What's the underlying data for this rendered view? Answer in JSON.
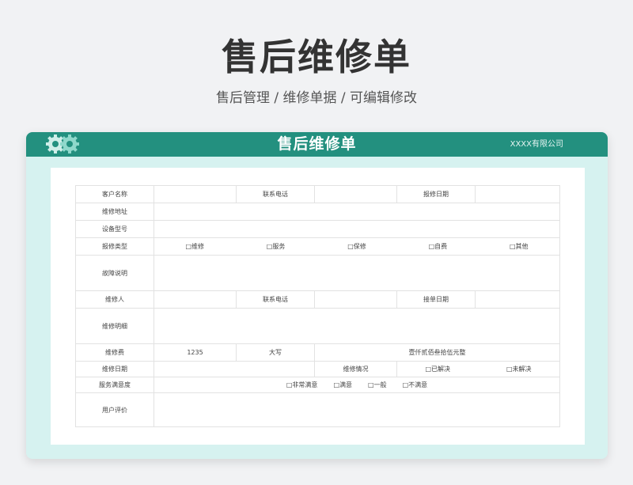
{
  "page": {
    "title": "售后维修单",
    "subtitle": "售后管理 /  维修单据  /  可编辑修改"
  },
  "card": {
    "title": "售后维修单",
    "company": "XXXX有限公司",
    "logo_icon": "gear-pair-icon",
    "colors": {
      "header": "#23907f",
      "card_bg": "#d6f2f0",
      "sheet_bg": "#ffffff"
    }
  },
  "form": {
    "customer_name_label": "客户名称",
    "contact_phone_label": "联系电话",
    "report_date_label": "报修日期",
    "repair_address_label": "维修地址",
    "device_model_label": "设备型号",
    "repair_type_label": "报修类型",
    "repair_type_options": [
      "□维修",
      "□服务",
      "□保修",
      "□自费",
      "□其他"
    ],
    "fault_desc_label": "故障说明",
    "repairer_label": "维修人",
    "contact_phone2_label": "联系电话",
    "accept_date_label": "接单日期",
    "repair_detail_label": "维修明细",
    "repair_fee_label": "维修费",
    "repair_fee_value": "1235",
    "capital_label": "大写",
    "capital_value": "壹仟贰佰叁拾伍元整",
    "repair_date_label": "维修日期",
    "repair_status_label": "维修情况",
    "repair_status_options": [
      "□已解决",
      "□未解决"
    ],
    "satisfaction_label": "服务满意度",
    "satisfaction_options": [
      "□非常满意",
      "□满意",
      "□一般",
      "□不满意"
    ],
    "user_review_label": "用户评价"
  }
}
